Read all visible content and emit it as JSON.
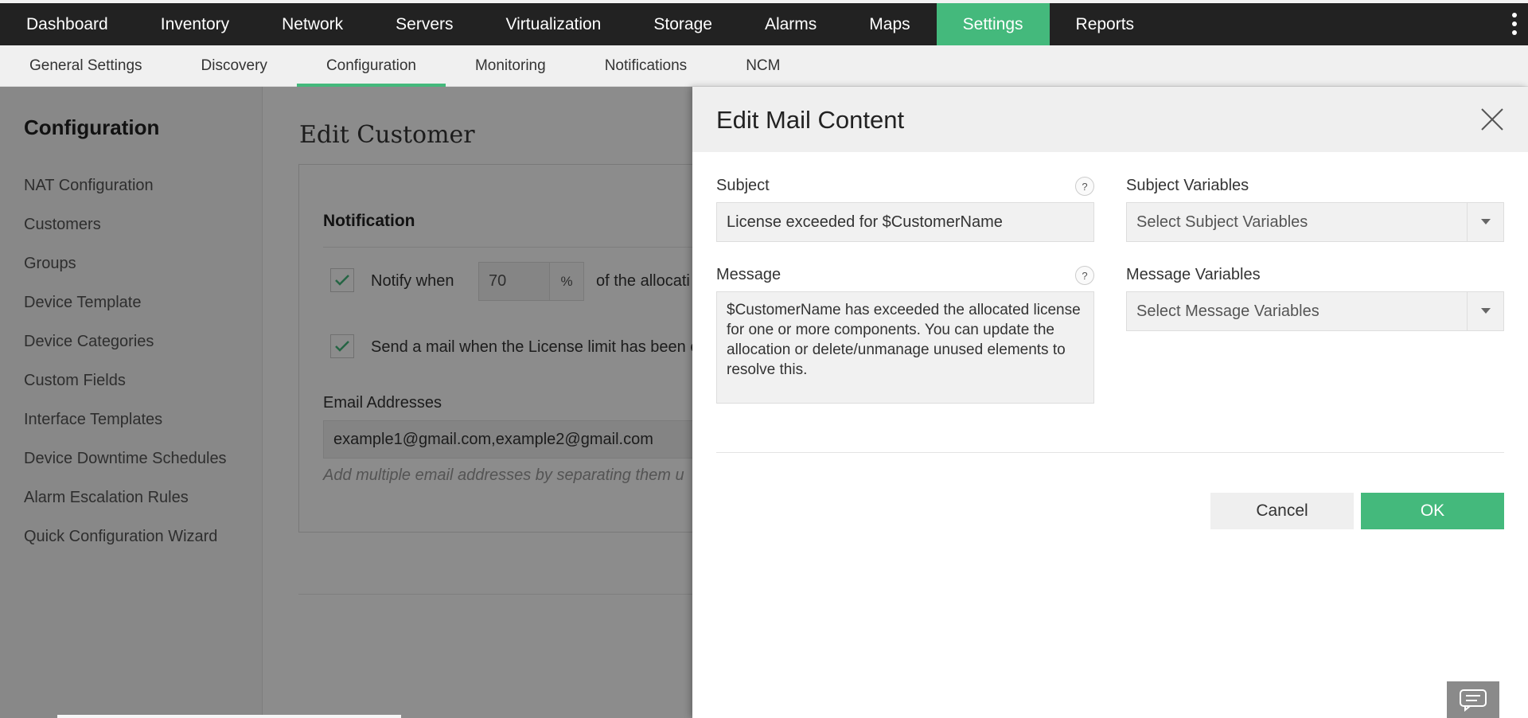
{
  "topnav": {
    "tabs": [
      "Dashboard",
      "Inventory",
      "Network",
      "Servers",
      "Virtualization",
      "Storage",
      "Alarms",
      "Maps",
      "Settings",
      "Reports"
    ],
    "active": "Settings",
    "more_icon": "vertical-ellipsis-icon"
  },
  "subnav": {
    "tabs": [
      "General Settings",
      "Discovery",
      "Configuration",
      "Monitoring",
      "Notifications",
      "NCM"
    ],
    "active": "Configuration"
  },
  "sidebar": {
    "title": "Configuration",
    "items": [
      "NAT Configuration",
      "Customers",
      "Groups",
      "Device Template",
      "Device Categories",
      "Custom Fields",
      "Interface Templates",
      "Device Downtime Schedules",
      "Alarm Escalation Rules",
      "Quick Configuration Wizard"
    ]
  },
  "main": {
    "page_title": "Edit Customer",
    "section_title": "Notification",
    "notify_label": "Notify when",
    "notify_value": "70",
    "percent_unit": "%",
    "notify_suffix": "of the allocati",
    "license_mail_label": "Send a mail when the License limit has been e",
    "email_label": "Email Addresses",
    "email_value": "example1@gmail.com,example2@gmail.com",
    "email_hint": "Add multiple email addresses by separating them u"
  },
  "dialog": {
    "title": "Edit Mail Content",
    "subject_label": "Subject",
    "subject_value": "License exceeded for $CustomerName",
    "message_label": "Message",
    "message_value": "$CustomerName has exceeded the allocated license for one or more components. You can update the allocation or delete/unmanage unused elements to resolve this.",
    "subject_vars_label": "Subject Variables",
    "subject_vars_placeholder": "Select Subject Variables",
    "message_vars_label": "Message Variables",
    "message_vars_placeholder": "Select Message Variables",
    "help_glyph": "?",
    "cancel_label": "Cancel",
    "ok_label": "OK"
  },
  "colors": {
    "accent": "#44b97c",
    "topnav_bg": "#222222"
  }
}
